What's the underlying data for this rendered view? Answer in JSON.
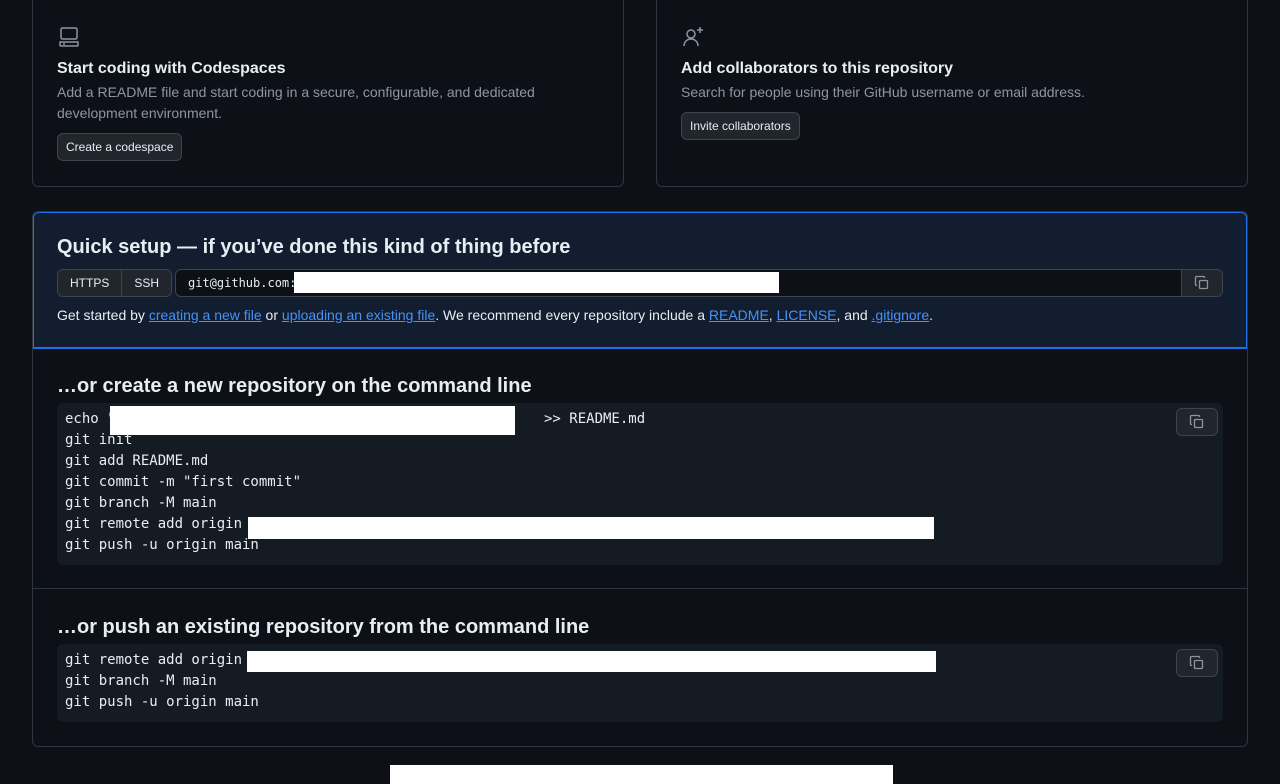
{
  "codespaces_card": {
    "icon": "codespaces-icon",
    "title": "Start coding with Codespaces",
    "description": "Add a README file and start coding in a secure, configurable, and dedicated development environment.",
    "button": "Create a codespace"
  },
  "collaborators_card": {
    "icon": "person-add-icon",
    "title": "Add collaborators to this repository",
    "description": "Search for people using their GitHub username or email address.",
    "button": "Invite collaborators"
  },
  "quick_setup": {
    "title": "Quick setup — if you’ve done this kind of thing before",
    "protocols": [
      "HTTPS",
      "SSH"
    ],
    "url_prefix": "git@github.com:",
    "get_started": {
      "t1": "Get started by ",
      "l1": "creating a new file",
      "t2": " or ",
      "l2": "uploading an existing file",
      "t3": ". We recommend every repository include a ",
      "l3": "README",
      "t4": ", ",
      "l4": "LICENSE",
      "t5": ", and ",
      "l5": ".gitignore",
      "t6": "."
    }
  },
  "new_repo": {
    "title": "…or create a new repository on the command line",
    "lines": [
      "echo \"",
      "git init",
      "git add README.md",
      "git commit -m \"first commit\"",
      "git branch -M main",
      "git remote add origin ",
      "git push -u origin main"
    ],
    "line0_suffix": ">> README.md"
  },
  "push_existing": {
    "title": "…or push an existing repository from the command line",
    "lines": [
      "git remote add origin ",
      "git branch -M main",
      "git push -u origin main"
    ]
  },
  "colors": {
    "background": "#0d1117",
    "accent_link": "#4493f8",
    "quick_setup_bg": "#121d2f",
    "quick_setup_border": "#1f6feb"
  }
}
